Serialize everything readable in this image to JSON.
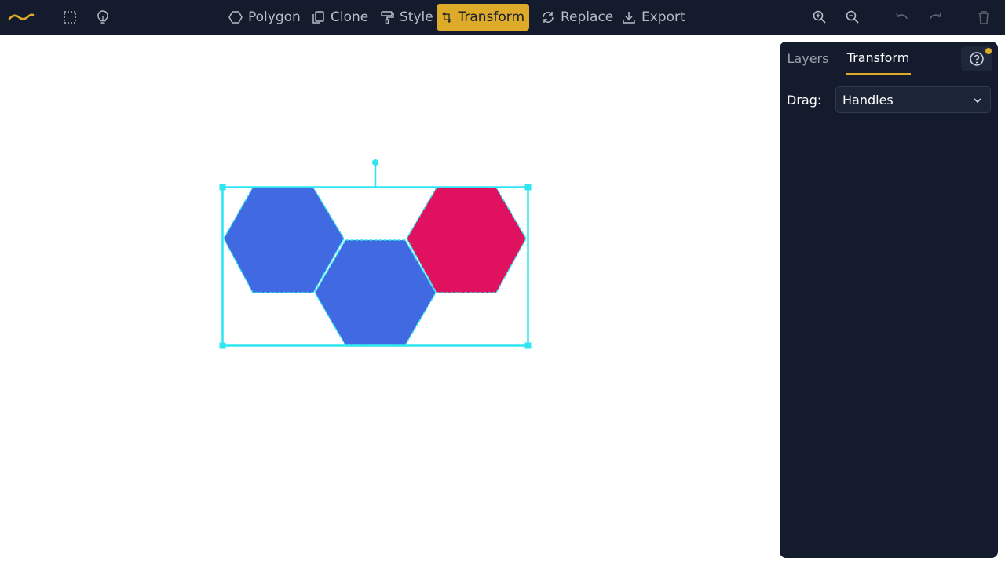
{
  "toolbar": {
    "logo_icon": "wave-logo-icon",
    "left_icons": [
      "marquee-select-icon",
      "lightbulb-icon"
    ],
    "buttons": [
      {
        "label": "Polygon",
        "icon": "hexagon-icon",
        "active": false
      },
      {
        "label": "Clone",
        "icon": "copy-icon",
        "active": false
      },
      {
        "label": "Style",
        "icon": "paint-roller-icon",
        "active": false
      },
      {
        "label": "Transform",
        "icon": "transform-icon",
        "active": true
      },
      {
        "label": "Replace",
        "icon": "replace-icon",
        "active": false
      },
      {
        "label": "Export",
        "icon": "download-icon",
        "active": false
      }
    ],
    "right_icons": [
      "zoom-in-icon",
      "zoom-out-icon",
      "undo-icon",
      "redo-icon",
      "trash-icon"
    ],
    "accent_color": "#ddaa2a",
    "background_color": "#141b2d"
  },
  "canvas": {
    "shapes": [
      {
        "type": "hexagon",
        "color": "#4169e1"
      },
      {
        "type": "hexagon",
        "color": "#4169e1"
      },
      {
        "type": "hexagon",
        "color": "#e0115f"
      }
    ],
    "selection_color": "#2ee6f0"
  },
  "panel": {
    "tabs": [
      {
        "label": "Layers",
        "active": false
      },
      {
        "label": "Transform",
        "active": true
      }
    ],
    "help_icon": "help-circle-icon",
    "drag": {
      "label": "Drag:",
      "value": "Handles"
    }
  }
}
